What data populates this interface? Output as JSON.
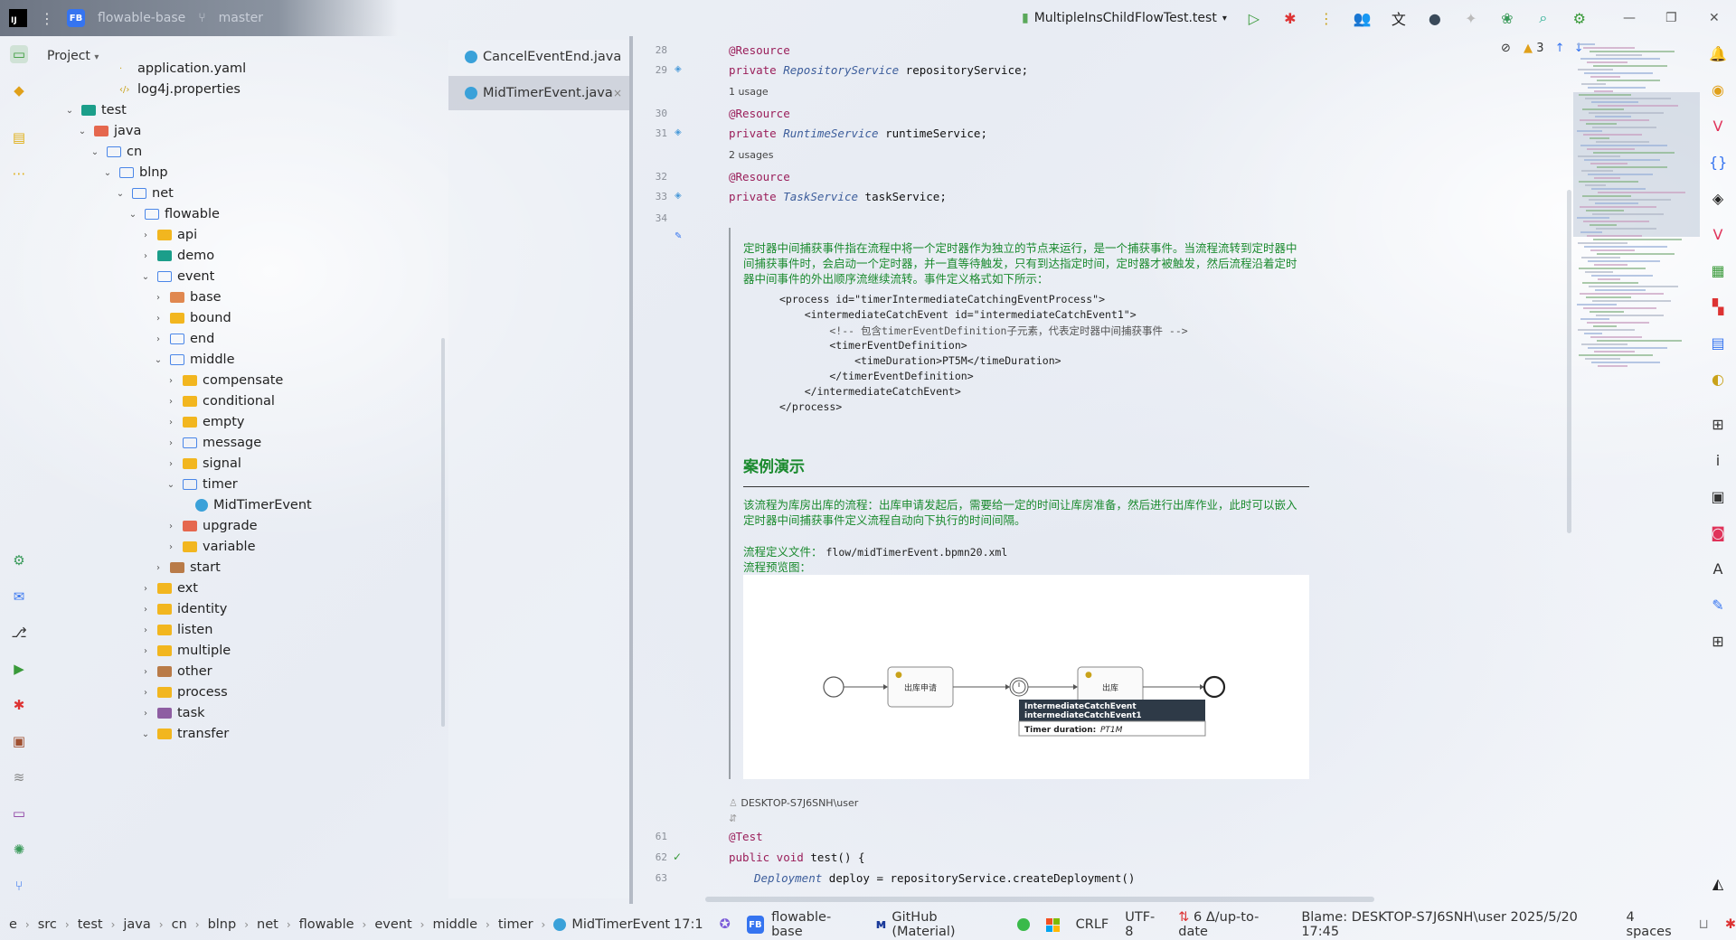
{
  "topbar": {
    "project_badge": "FB",
    "project_name": "flowable-base",
    "branch": "master",
    "run_config": "MultipleInsChildFlowTest.test"
  },
  "project_panel": {
    "title": "Project",
    "tree": [
      {
        "label": "application.yaml",
        "icon": "yaml-file-icon",
        "depth": 5,
        "chev": ""
      },
      {
        "label": "log4j.properties",
        "icon": "properties-file-icon",
        "depth": 5,
        "chev": ""
      },
      {
        "label": "test",
        "icon": "folder-test",
        "depth": 2,
        "chev": "open"
      },
      {
        "label": "java",
        "icon": "folder-red",
        "depth": 3,
        "chev": "open"
      },
      {
        "label": "cn",
        "icon": "folder-outline",
        "depth": 4,
        "chev": "open"
      },
      {
        "label": "blnp",
        "icon": "folder-outline",
        "depth": 5,
        "chev": "open"
      },
      {
        "label": "net",
        "icon": "folder-outline",
        "depth": 6,
        "chev": "open"
      },
      {
        "label": "flowable",
        "icon": "folder-outline",
        "depth": 7,
        "chev": "open"
      },
      {
        "label": "api",
        "icon": "folder-api",
        "depth": 8,
        "chev": "closed"
      },
      {
        "label": "demo",
        "icon": "folder-teal",
        "depth": 8,
        "chev": "closed"
      },
      {
        "label": "event",
        "icon": "folder-outline",
        "depth": 8,
        "chev": "open"
      },
      {
        "label": "base",
        "icon": "folder-orange",
        "depth": 9,
        "chev": "closed"
      },
      {
        "label": "bound",
        "icon": "folder-yellow",
        "depth": 9,
        "chev": "closed"
      },
      {
        "label": "end",
        "icon": "folder-outline",
        "depth": 9,
        "chev": "closed"
      },
      {
        "label": "middle",
        "icon": "folder-outline",
        "depth": 9,
        "chev": "open"
      },
      {
        "label": "compensate",
        "icon": "folder-yellow",
        "depth": 10,
        "chev": "closed"
      },
      {
        "label": "conditional",
        "icon": "folder-yellow",
        "depth": 10,
        "chev": "closed"
      },
      {
        "label": "empty",
        "icon": "folder-yellow",
        "depth": 10,
        "chev": "closed"
      },
      {
        "label": "message",
        "icon": "folder-blue",
        "depth": 10,
        "chev": "closed"
      },
      {
        "label": "signal",
        "icon": "folder-yellow",
        "depth": 10,
        "chev": "closed"
      },
      {
        "label": "timer",
        "icon": "folder-outline",
        "depth": 10,
        "chev": "open"
      },
      {
        "label": "MidTimerEvent",
        "icon": "java-class-icon",
        "depth": 11,
        "chev": ""
      },
      {
        "label": "upgrade",
        "icon": "folder-red",
        "depth": 10,
        "chev": "closed"
      },
      {
        "label": "variable",
        "icon": "folder-yellow",
        "depth": 10,
        "chev": "closed"
      },
      {
        "label": "start",
        "icon": "folder-brown",
        "depth": 9,
        "chev": "closed"
      },
      {
        "label": "ext",
        "icon": "folder-yellow",
        "depth": 8,
        "chev": "closed"
      },
      {
        "label": "identity",
        "icon": "folder-yellow",
        "depth": 8,
        "chev": "closed"
      },
      {
        "label": "listen",
        "icon": "folder-yellow",
        "depth": 8,
        "chev": "closed"
      },
      {
        "label": "multiple",
        "icon": "folder-yellow",
        "depth": 8,
        "chev": "closed"
      },
      {
        "label": "other",
        "icon": "folder-brown",
        "depth": 8,
        "chev": "closed"
      },
      {
        "label": "process",
        "icon": "folder-yellow",
        "depth": 8,
        "chev": "closed"
      },
      {
        "label": "task",
        "icon": "folder-purple",
        "depth": 8,
        "chev": "closed"
      },
      {
        "label": "transfer",
        "icon": "folder-yellow",
        "depth": 8,
        "chev": "open"
      }
    ]
  },
  "open_files": [
    {
      "label": "CancelEventEnd.java",
      "active": false
    },
    {
      "label": "MidTimerEvent.java",
      "active": true,
      "close": "×"
    }
  ],
  "editor": {
    "warnings": "3",
    "lines_top": [
      {
        "num": "28",
        "html": "@Resource",
        "kind": "annot"
      },
      {
        "num": "29",
        "kw": "private ",
        "type": "RepositoryService",
        "rest": " repositoryService;"
      },
      {
        "hint": "1 usage"
      },
      {
        "num": "30",
        "html": "@Resource",
        "kind": "annot"
      },
      {
        "num": "31",
        "kw": "private ",
        "type": "RuntimeService",
        "rest": " runtimeService;"
      },
      {
        "hint": "2 usages"
      },
      {
        "num": "32",
        "html": "@Resource",
        "kind": "annot"
      },
      {
        "num": "33",
        "kw": "private ",
        "type": "TaskService",
        "rest": " taskService;"
      },
      {
        "num": "34",
        "html": ""
      }
    ],
    "doc": {
      "intro": "定时器中间捕获事件指在流程中将一个定时器作为独立的节点来运行，是一个捕获事件。当流程流转到定时器中间捕获事件时，会启动一个定时器，并一直等待触发，只有到达指定时间，定时器才被触发，然后流程沿着定时器中间事件的外出顺序流继续流转。事件定义格式如下所示：",
      "xml_lines": [
        "<process id=\"timerIntermediateCatchingEventProcess\">",
        "    <intermediateCatchEvent id=\"intermediateCatchEvent1\">",
        "        <!-- 包含timerEventDefinition子元素，代表定时器中间捕获事件 -->",
        "        <timerEventDefinition>",
        "            <timeDuration>PT5M</timeDuration>",
        "        </timerEventDefinition>",
        "    </intermediateCatchEvent>",
        "</process>"
      ],
      "heading": "案例演示",
      "case_text": "该流程为库房出库的流程：出库申请发起后，需要给一定的时间让库房准备，然后进行出库作业，此时可以嵌入定时器中间捕获事件定义流程自动向下执行的时间间隔。",
      "def_label": "流程定义文件：",
      "def_value": "flow/midTimerEvent.bpmn20.xml",
      "preview_label": "流程预览图：",
      "diagram": {
        "task1": "出库申请",
        "task2": "出库",
        "tooltip_title1": "IntermediateCatchEvent",
        "tooltip_title2": "intermediateCatchEvent1",
        "tooltip_label": "Timer duration:",
        "tooltip_value": "PT1M"
      }
    },
    "author": "DESKTOP-S7J6SNH\\user",
    "lines_bottom": [
      {
        "num": "61",
        "text": "@Test"
      },
      {
        "num": "62",
        "kw": "public void ",
        "rest": "test() {"
      },
      {
        "num": "63",
        "type": "Deployment",
        "rest": " deploy = repositoryService.createDeployment()"
      }
    ]
  },
  "statusbar": {
    "crumbs": [
      "e",
      "src",
      "test",
      "java",
      "cn",
      "blnp",
      "net",
      "flowable",
      "event",
      "middle",
      "timer",
      "MidTimerEvent"
    ],
    "position": "17:1",
    "project_badge": "FB",
    "project": "flowable-base",
    "theme": "GitHub (Material)",
    "line_sep": "CRLF",
    "encoding": "UTF-8",
    "vcs": "6 Δ/up-to-date",
    "blame": "Blame: DESKTOP-S7J6SNH\\user 2025/5/20 17:45",
    "indent": "4 spaces"
  }
}
